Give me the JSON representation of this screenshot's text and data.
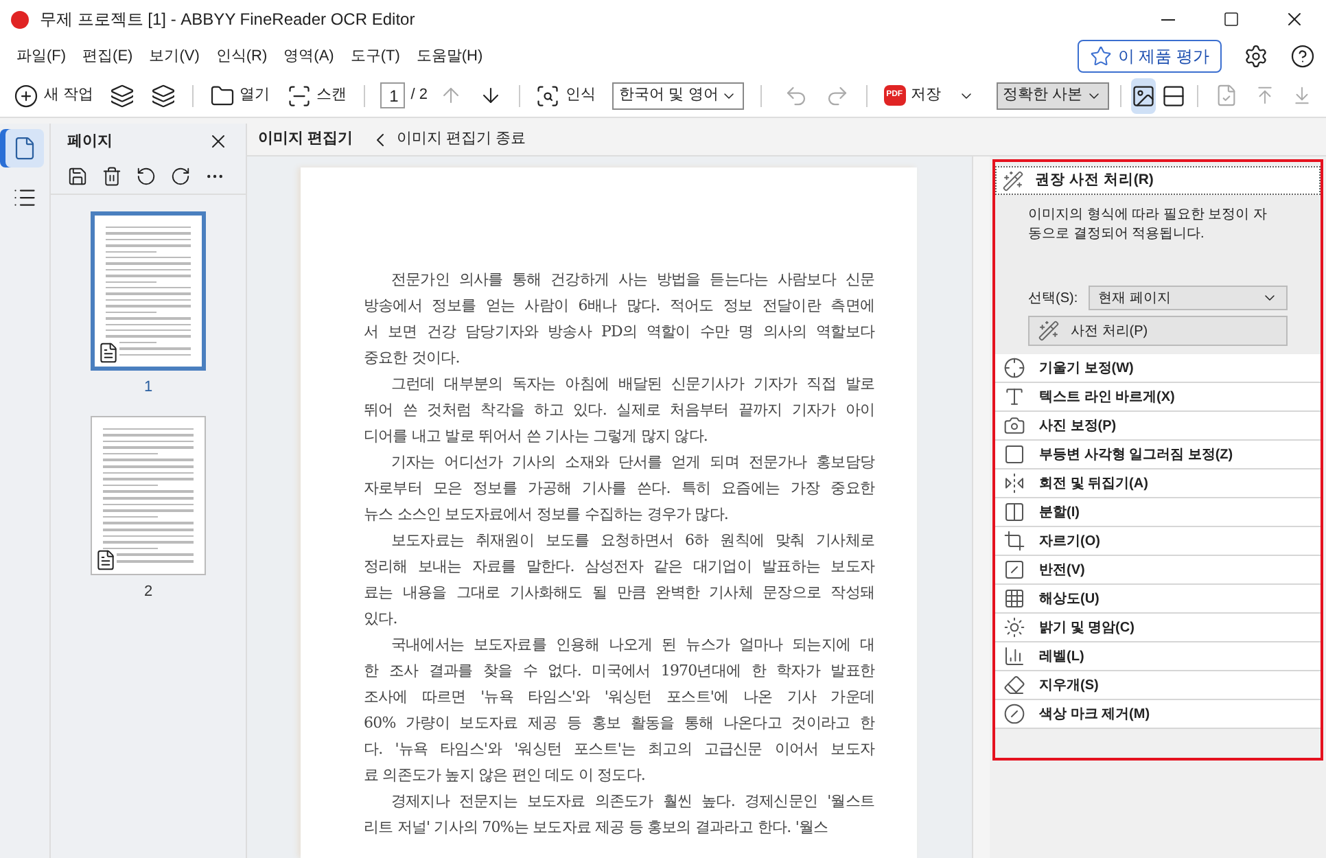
{
  "window": {
    "title": "무제 프로젝트 [1] - ABBYY FineReader OCR Editor"
  },
  "menu": [
    "파일(F)",
    "편집(E)",
    "보기(V)",
    "인식(R)",
    "영역(A)",
    "도구(T)",
    "도움말(H)"
  ],
  "rate_button": "이 제품 평가",
  "toolbar": {
    "new_task": "새 작업",
    "open": "열기",
    "scan": "스캔",
    "page_value": "1",
    "page_total": "/ 2",
    "recognize": "인식",
    "language": "한국어 및 영어",
    "pdf_badge": "PDF",
    "save": "저장",
    "mode": "정확한 사본",
    "image_view_selected": true,
    "text_view_selected": false
  },
  "rail": [
    {
      "kind": "pages",
      "selected": true
    },
    {
      "kind": "outline",
      "selected": false
    }
  ],
  "pages_panel": {
    "title": "페이지",
    "thumbnails": [
      {
        "number": "1",
        "selected": true
      },
      {
        "number": "2",
        "selected": false
      }
    ]
  },
  "editor": {
    "tab": "이미지 편집기",
    "exit": "이미지 편집기 종료"
  },
  "document": {
    "paragraphs": [
      [
        "전문가인 의사를 통해 건강하게 사는 방법을 듣는다는 사람보다 신문",
        "방송에서 정보를 얻는 사람이 6배나 많다. 적어도 정보 전달이란 측면에",
        "서 보면 건강 담당기자와 방송사 PD의 역할이 수만 명 의사의 역할보다",
        "중요한 것이다."
      ],
      [
        "그런데 대부분의 독자는 아침에 배달된 신문기사가 기자가 직접 발로",
        "뛰어 쓴 것처럼 착각을 하고 있다. 실제로 처음부터 끝까지 기자가 아이",
        "디어를 내고 발로 뛰어서 쓴 기사는 그렇게 많지 않다."
      ],
      [
        "기자는 어디선가 기사의 소재와 단서를 얻게 되며 전문가나 홍보담당",
        "자로부터 모은 정보를 가공해 기사를 쓴다. 특히 요즘에는 가장 중요한",
        "뉴스 소스인 보도자료에서 정보를 수집하는 경우가 많다."
      ],
      [
        "보도자료는 취재원이 보도를 요청하면서 6하 원칙에 맞춰 기사체로",
        "정리해 보내는 자료를 말한다. 삼성전자 같은 대기업이 발표하는 보도자",
        "료는 내용을 그대로 기사화해도 될 만큼 완벽한 기사체 문장으로 작성돼",
        "있다."
      ],
      [
        "국내에서는 보도자료를 인용해 나오게 된 뉴스가 얼마나 되는지에 대",
        "한 조사 결과를 찾을 수 없다. 미국에서 1970년대에 한 학자가 발표한",
        "조사에 따르면 '뉴욕 타임스'와 '워싱턴 포스트'에 나온 기사 가운데",
        "60% 가량이 보도자료 제공 등 홍보 활동을 통해 나온다고 것이라고 한",
        "다. '뉴욕 타임스'와 '워싱턴 포스트'는 최고의 고급신문 이어서 보도자",
        "료 의존도가 높지 않은 편인 데도 이 정도다."
      ],
      [
        "경제지나 전문지는 보도자료 의존도가 훨씬 높다. 경제신문인 '월스트",
        "리트 저널' 기사의 70%는 보도자료 제공 등 홍보의 결과라고 한다. '월스"
      ]
    ]
  },
  "preprocess": {
    "title": "권장 사전 처리(R)",
    "expanded": true,
    "description": "이미지의 형식에 따라 필요한 보정이 자동으로 결정되어 적용됩니다.",
    "select_label": "선택(S):",
    "select_value": "현재 페이지",
    "button": "사전 처리(P)"
  },
  "tools": [
    "기울기 보정(W)",
    "텍스트 라인 바르게(X)",
    "사진 보정(P)",
    "부등변 사각형 일그러짐 보정(Z)",
    "회전 및 뒤집기(A)",
    "분할(I)",
    "자르기(O)",
    "반전(V)",
    "해상도(U)",
    "밝기 및 명암(C)",
    "레벨(L)",
    "지우개(S)",
    "색상 마크 제거(M)"
  ]
}
